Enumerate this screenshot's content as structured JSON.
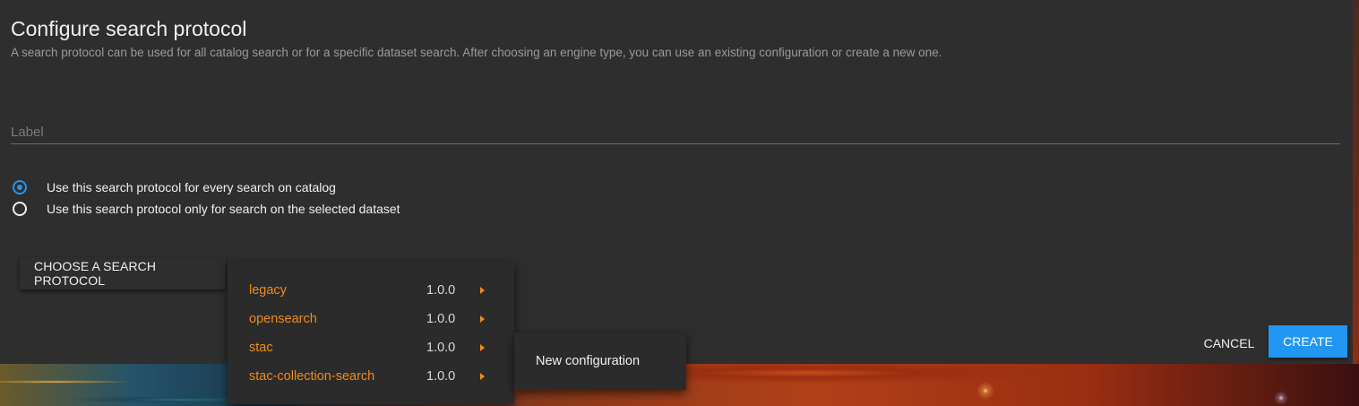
{
  "dialog": {
    "title": "Configure search protocol",
    "subtitle": "A search protocol can be used for all catalog search or for a specific dataset search. After choosing an engine type, you can use an existing configuration or create a new one."
  },
  "label_field": {
    "placeholder": "Label",
    "value": ""
  },
  "scope_options": [
    {
      "label": "Use this search protocol for every search on catalog",
      "selected": true
    },
    {
      "label": "Use this search protocol only for search on the selected dataset",
      "selected": false
    }
  ],
  "choose_button": {
    "label": "CHOOSE A SEARCH PROTOCOL"
  },
  "protocol_menu": {
    "items": [
      {
        "name": "legacy",
        "version": "1.0.0"
      },
      {
        "name": "opensearch",
        "version": "1.0.0"
      },
      {
        "name": "stac",
        "version": "1.0.0"
      },
      {
        "name": "stac-collection-search",
        "version": "1.0.0"
      }
    ]
  },
  "submenu": {
    "item": "New configuration"
  },
  "actions": {
    "cancel_label": "CANCEL",
    "create_label": "CREATE"
  },
  "colors": {
    "accent": "#2196f3",
    "menu_text": "#f28a1c",
    "background": "#2e2e2e"
  }
}
